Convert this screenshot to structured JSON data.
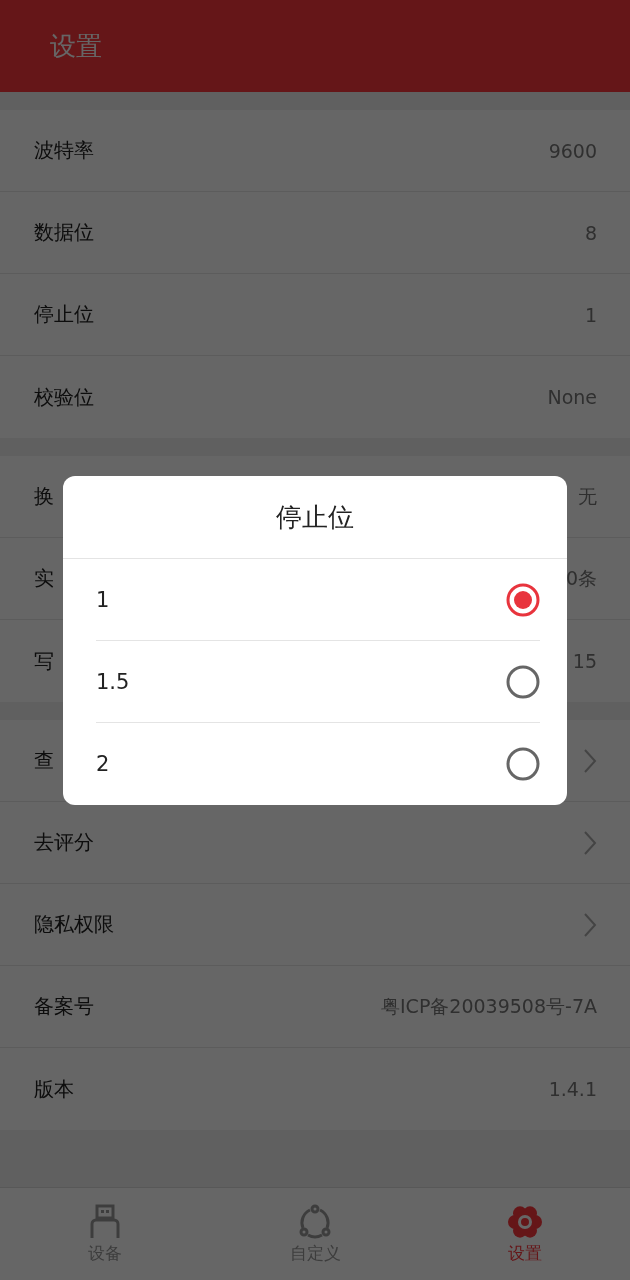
{
  "header": {
    "title": "设置"
  },
  "sections": [
    {
      "rows": [
        {
          "kind": "value",
          "label": "波特率",
          "value": "9600"
        },
        {
          "kind": "value",
          "label": "数据位",
          "value": "8"
        },
        {
          "kind": "value",
          "label": "停止位",
          "value": "1"
        },
        {
          "kind": "value",
          "label": "校验位",
          "value": "None"
        }
      ]
    },
    {
      "rows": [
        {
          "kind": "value",
          "label": "换",
          "value": "无"
        },
        {
          "kind": "value",
          "label": "实",
          "value": "0条"
        },
        {
          "kind": "value",
          "label": "写",
          "value": "15"
        }
      ]
    },
    {
      "rows": [
        {
          "kind": "link",
          "label": "查"
        },
        {
          "kind": "link",
          "label": "去评分"
        },
        {
          "kind": "link",
          "label": "隐私权限"
        },
        {
          "kind": "value",
          "label": "备案号",
          "value": "粤ICP备20039508号-7A"
        },
        {
          "kind": "value",
          "label": "版本",
          "value": "1.4.1"
        }
      ]
    }
  ],
  "dialog": {
    "title": "停止位",
    "options": [
      {
        "label": "1",
        "selected": true
      },
      {
        "label": "1.5",
        "selected": false
      },
      {
        "label": "2",
        "selected": false
      }
    ]
  },
  "nav": [
    {
      "kind": "device",
      "label": "设备",
      "selected": false
    },
    {
      "kind": "custom",
      "label": "自定义",
      "selected": false
    },
    {
      "kind": "settings",
      "label": "设置",
      "selected": true
    }
  ]
}
